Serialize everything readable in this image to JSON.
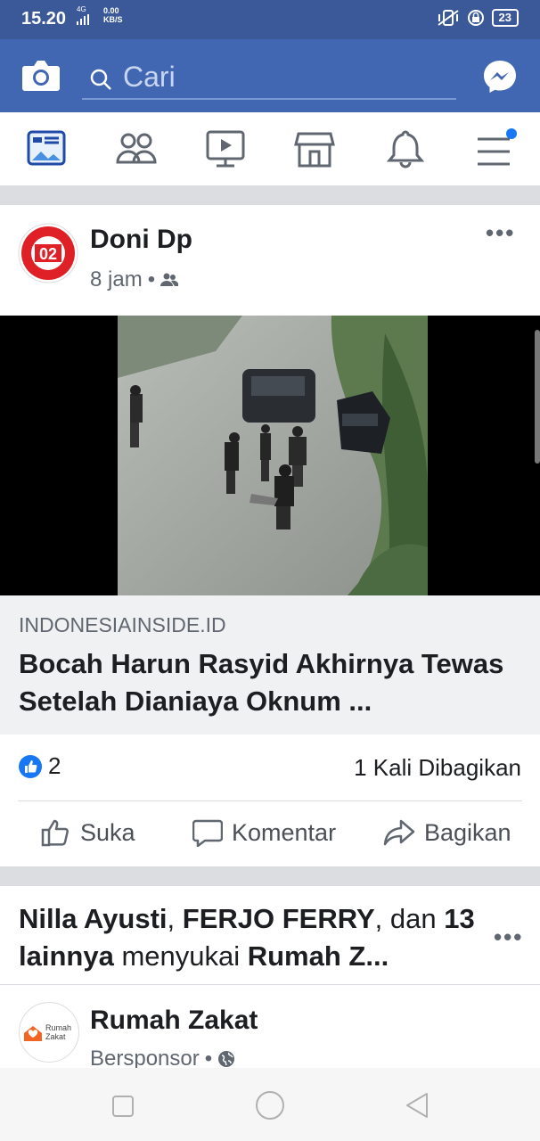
{
  "status_bar": {
    "time": "15.20",
    "network": "4G",
    "speed_value": "0.00",
    "speed_unit": "KB/S",
    "battery": "23"
  },
  "header": {
    "search_placeholder": "Cari"
  },
  "nav": {
    "items": [
      "news-feed-icon",
      "groups-icon",
      "watch-icon",
      "marketplace-icon",
      "notifications-icon",
      "menu-icon"
    ]
  },
  "post": {
    "author": "Doni Dp",
    "time": "8 jam",
    "avatar_text": "02",
    "avatar_top": "PASLONG PRESIDEN RI",
    "avatar_bottom": "MENANG",
    "link": {
      "domain": "INDONESIAINSIDE.ID",
      "title": "Bocah Harun Rasyid Akhirnya Tewas Setelah Dianiaya Oknum ..."
    },
    "reactions": "2",
    "shares": "1 Kali Dibagikan",
    "actions": {
      "like": "Suka",
      "comment": "Komentar",
      "share": "Bagikan"
    }
  },
  "suggested": {
    "name1": "Nilla Ayusti",
    "sep": ", ",
    "name2": "FERJO FERRY",
    "and": ", dan",
    "others": "13 lainnya",
    "verb": " menyukai ",
    "page": "Rumah Z...",
    "sponsor": {
      "name": "Rumah Zakat",
      "label": "Bersponsor",
      "logo_text_1": "Rumah",
      "logo_text_2": "Zakat"
    }
  },
  "colors": {
    "facebook_blue": "#4267b2",
    "status_blue": "#3b5998",
    "like_blue": "#1877f2"
  }
}
